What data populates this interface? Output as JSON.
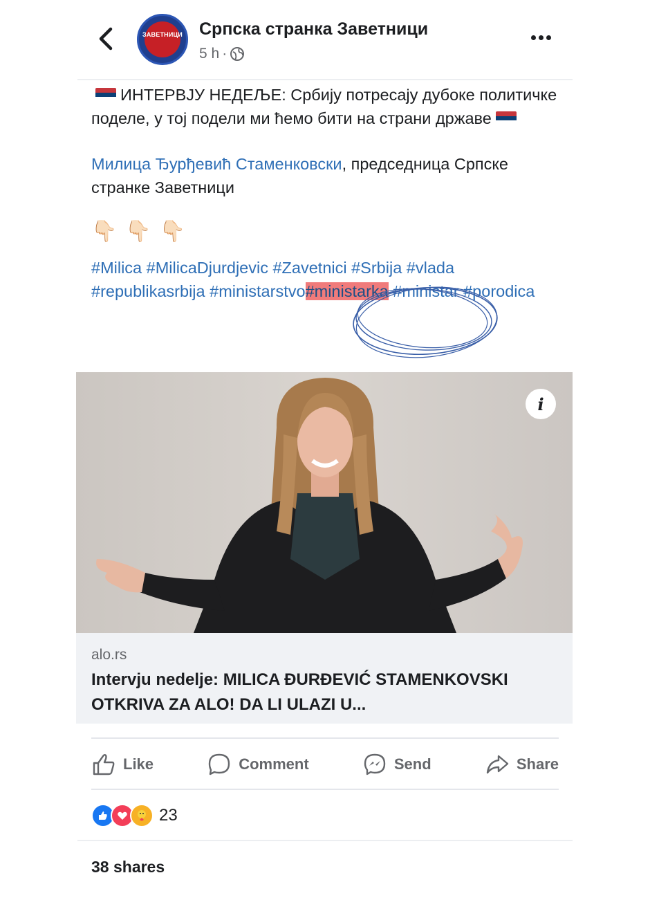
{
  "header": {
    "page_name": "Српска странка Заветници",
    "time": "5 h",
    "separator": "·",
    "avatar_text": "ЗАВЕТНИЦИ",
    "audience_icon": "globe-icon",
    "back_icon": "chevron-left-icon",
    "more_icon": "more-dots-icon"
  },
  "post": {
    "line1": "ИНТЕРВЈУ НЕДЕЉЕ: Србију потресају дубоке политичке поделе, у тој подели ми ћемо бити на страни државе",
    "author_link": "Милица Ђурђевић Стаменковски",
    "author_rest": ", председница Српске странке Заветници",
    "pointers": [
      "👇🏻",
      "👇🏻",
      "👇🏻"
    ],
    "hashtags_before": "#Milica #MilicaDjurdjevic #Zavetnici #Srbija #vlada #republikasrbija #ministarstvo",
    "hashtag_highlight": "#ministarka",
    "hashtags_after": " #ministar #porodica"
  },
  "link_preview": {
    "domain": "alo.rs",
    "headline": "Intervju nedelje: MILICA ĐURĐEVIĆ STAMENKOVSKI OTKRIVA ZA ALO! DA LI ULAZI U..."
  },
  "actions": [
    {
      "label": "Like",
      "icon": "thumbs-up-icon"
    },
    {
      "label": "Comment",
      "icon": "comment-bubble-icon"
    },
    {
      "label": "Send",
      "icon": "messenger-icon"
    },
    {
      "label": "Share",
      "icon": "share-arrow-icon"
    }
  ],
  "reactions": {
    "count": "23",
    "types": [
      "like",
      "love",
      "care"
    ]
  },
  "shares": "38 shares",
  "colors": {
    "link": "#2f6fb6",
    "highlight": "#f07b7b",
    "muted": "#65676b"
  }
}
